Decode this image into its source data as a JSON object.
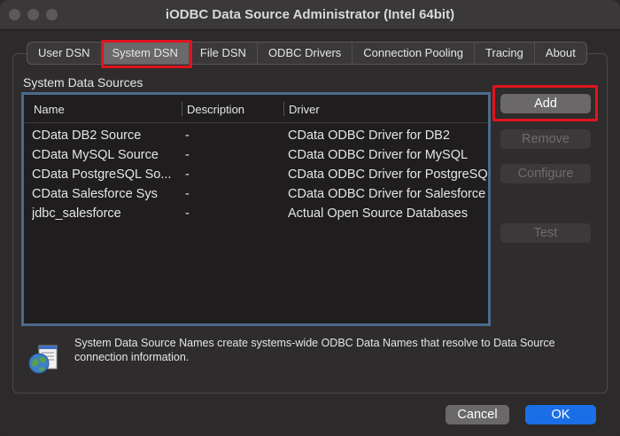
{
  "window": {
    "title": "iODBC Data Source Administrator (Intel 64bit)"
  },
  "tabs": [
    {
      "label": "User DSN"
    },
    {
      "label": "System DSN"
    },
    {
      "label": "File DSN"
    },
    {
      "label": "ODBC Drivers"
    },
    {
      "label": "Connection Pooling"
    },
    {
      "label": "Tracing"
    },
    {
      "label": "About"
    }
  ],
  "active_tab": "System DSN",
  "section": {
    "label": "System Data Sources"
  },
  "table": {
    "columns": [
      "Name",
      "Description",
      "Driver"
    ],
    "rows": [
      {
        "name": "CData DB2 Source",
        "description": "-",
        "driver": "CData ODBC Driver for DB2"
      },
      {
        "name": "CData MySQL Source",
        "description": "-",
        "driver": "CData ODBC Driver for MySQL"
      },
      {
        "name": "CData PostgreSQL So...",
        "description": "-",
        "driver": "CData ODBC Driver for PostgreSQL"
      },
      {
        "name": "CData Salesforce Sys",
        "description": "-",
        "driver": "CData ODBC Driver for Salesforce"
      },
      {
        "name": "jdbc_salesforce",
        "description": "-",
        "driver": "Actual Open Source Databases"
      }
    ]
  },
  "buttons": {
    "add": "Add",
    "remove": "Remove",
    "configure": "Configure",
    "test": "Test",
    "cancel": "Cancel",
    "ok": "OK"
  },
  "info": {
    "text": "System Data Source Names create systems-wide ODBC Data Names that resolve to Data Source connection information.",
    "icon": "globe-document-icon"
  },
  "colors": {
    "highlight": "#e0141e",
    "ok_button": "#1a6fe6",
    "list_border": "#4b6a8c"
  }
}
